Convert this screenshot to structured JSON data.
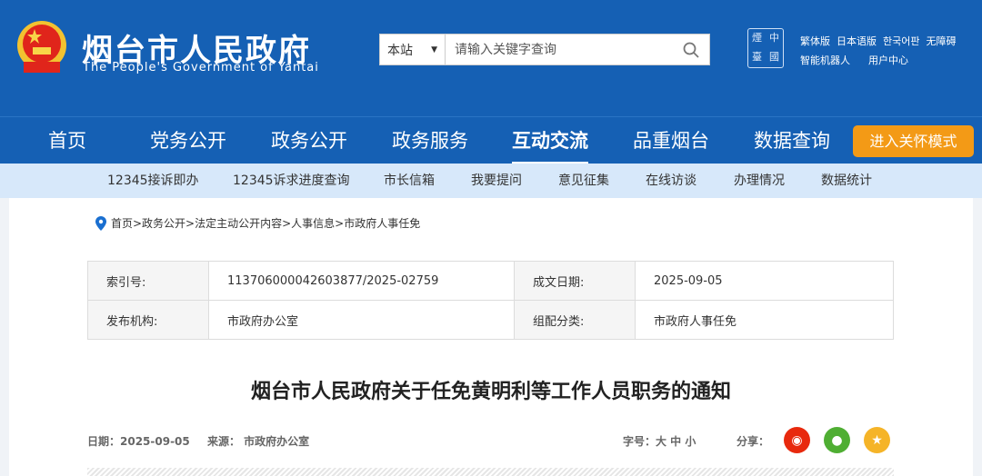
{
  "header": {
    "title": "烟台市人民政府",
    "subtitle": "The People's Government of Yantai",
    "search": {
      "scope": "本站",
      "placeholder": "请输入关键字查询"
    },
    "seal_text": [
      "煙",
      "中",
      "臺",
      "國"
    ],
    "links": [
      "繁体版",
      "日本语版",
      "한국어판",
      "无障碍",
      "智能机器人",
      "用户中心"
    ]
  },
  "nav": {
    "items": [
      "首页",
      "党务公开",
      "政务公开",
      "政务服务",
      "互动交流",
      "品重烟台",
      "数据查询"
    ],
    "active": "互动交流",
    "care_button": "进入关怀模式"
  },
  "subnav": [
    "12345接诉即办",
    "12345诉求进度查询",
    "市长信箱",
    "我要提问",
    "意见征集",
    "在线访谈",
    "办理情况",
    "数据统计"
  ],
  "breadcrumb": "首页>政务公开>法定主动公开内容>人事信息>市政府人事任免",
  "info": {
    "index_label": "索引号:",
    "index_value": "113706000042603877/2025-02759",
    "date_label": "成文日期:",
    "date_value": "2025-09-05",
    "org_label": "发布机构:",
    "org_value": "市政府办公室",
    "category_label": "组配分类:",
    "category_value": "市政府人事任免"
  },
  "document": {
    "title": "烟台市人民政府关于任免黄明利等工作人员职务的通知",
    "date": "日期：2025-09-05",
    "source": "来源：  市政府办公室",
    "font_size": "字号：大 中 小",
    "share": "分享：",
    "share_colors": {
      "weibo": "#e8290d",
      "wechat": "#4fae33",
      "favorite": "#f5b428"
    }
  }
}
